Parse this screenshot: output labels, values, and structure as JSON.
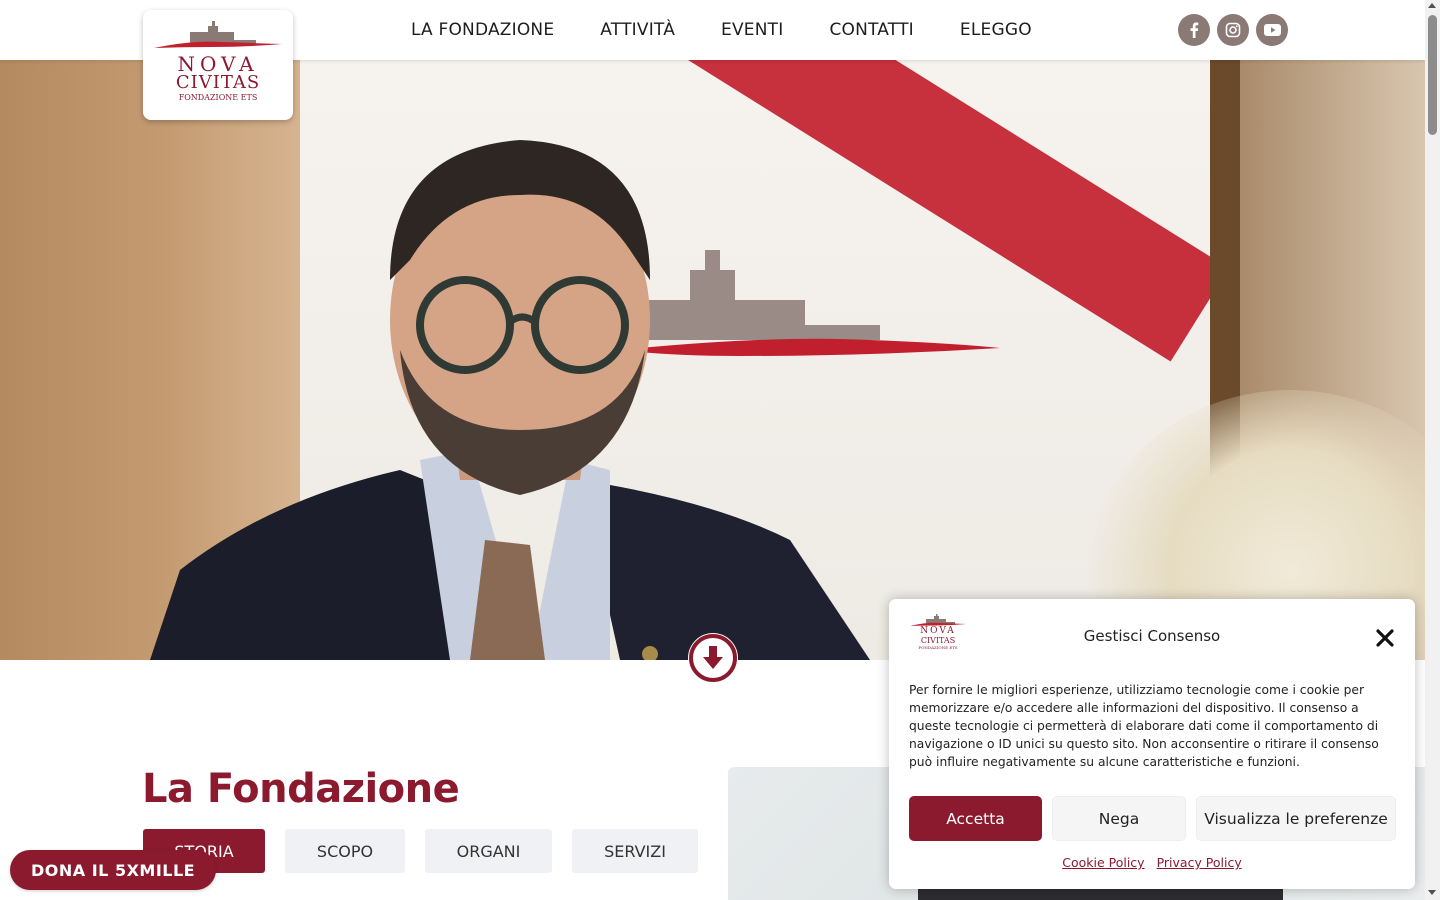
{
  "brand": {
    "logo_line1": "NOVA",
    "logo_line2": "CIVITAS",
    "logo_line3": "FONDAZIONE ETS",
    "primary_color": "#8b1a2f",
    "social_color": "#8a7975"
  },
  "nav": {
    "items": [
      {
        "label": "LA FONDAZIONE"
      },
      {
        "label": "ATTIVITÀ"
      },
      {
        "label": "EVENTI"
      },
      {
        "label": "CONTATTI"
      },
      {
        "label": "ELEGGO"
      }
    ]
  },
  "social": [
    {
      "icon": "facebook-icon"
    },
    {
      "icon": "instagram-icon"
    },
    {
      "icon": "youtube-icon"
    }
  ],
  "hero": {
    "scroll_icon": "arrow-down-circle-icon"
  },
  "section": {
    "title": "La Fondazione",
    "tabs": [
      {
        "label": "STORIA",
        "active": true
      },
      {
        "label": "SCOPO",
        "active": false
      },
      {
        "label": "ORGANI",
        "active": false
      },
      {
        "label": "SERVIZI",
        "active": false
      }
    ]
  },
  "donate": {
    "label": "DONA IL 5XMILLE"
  },
  "cookie": {
    "logo_line1": "NOVA",
    "logo_line2": "CIVITAS",
    "logo_line3": "FONDAZIONE ETS",
    "title": "Gestisci Consenso",
    "text": "Per fornire le migliori esperienze, utilizziamo tecnologie come i cookie per memorizzare e/o accedere alle informazioni del dispositivo. Il consenso a queste tecnologie ci permetterà di elaborare dati come il comportamento di navigazione o ID unici su questo sito. Non acconsentire o ritirare il consenso può influire negativamente su alcune caratteristiche e funzioni.",
    "accept_label": "Accetta",
    "deny_label": "Nega",
    "prefs_label": "Visualizza le preferenze",
    "cookie_policy_label": "Cookie Policy",
    "privacy_policy_label": "Privacy Policy"
  }
}
